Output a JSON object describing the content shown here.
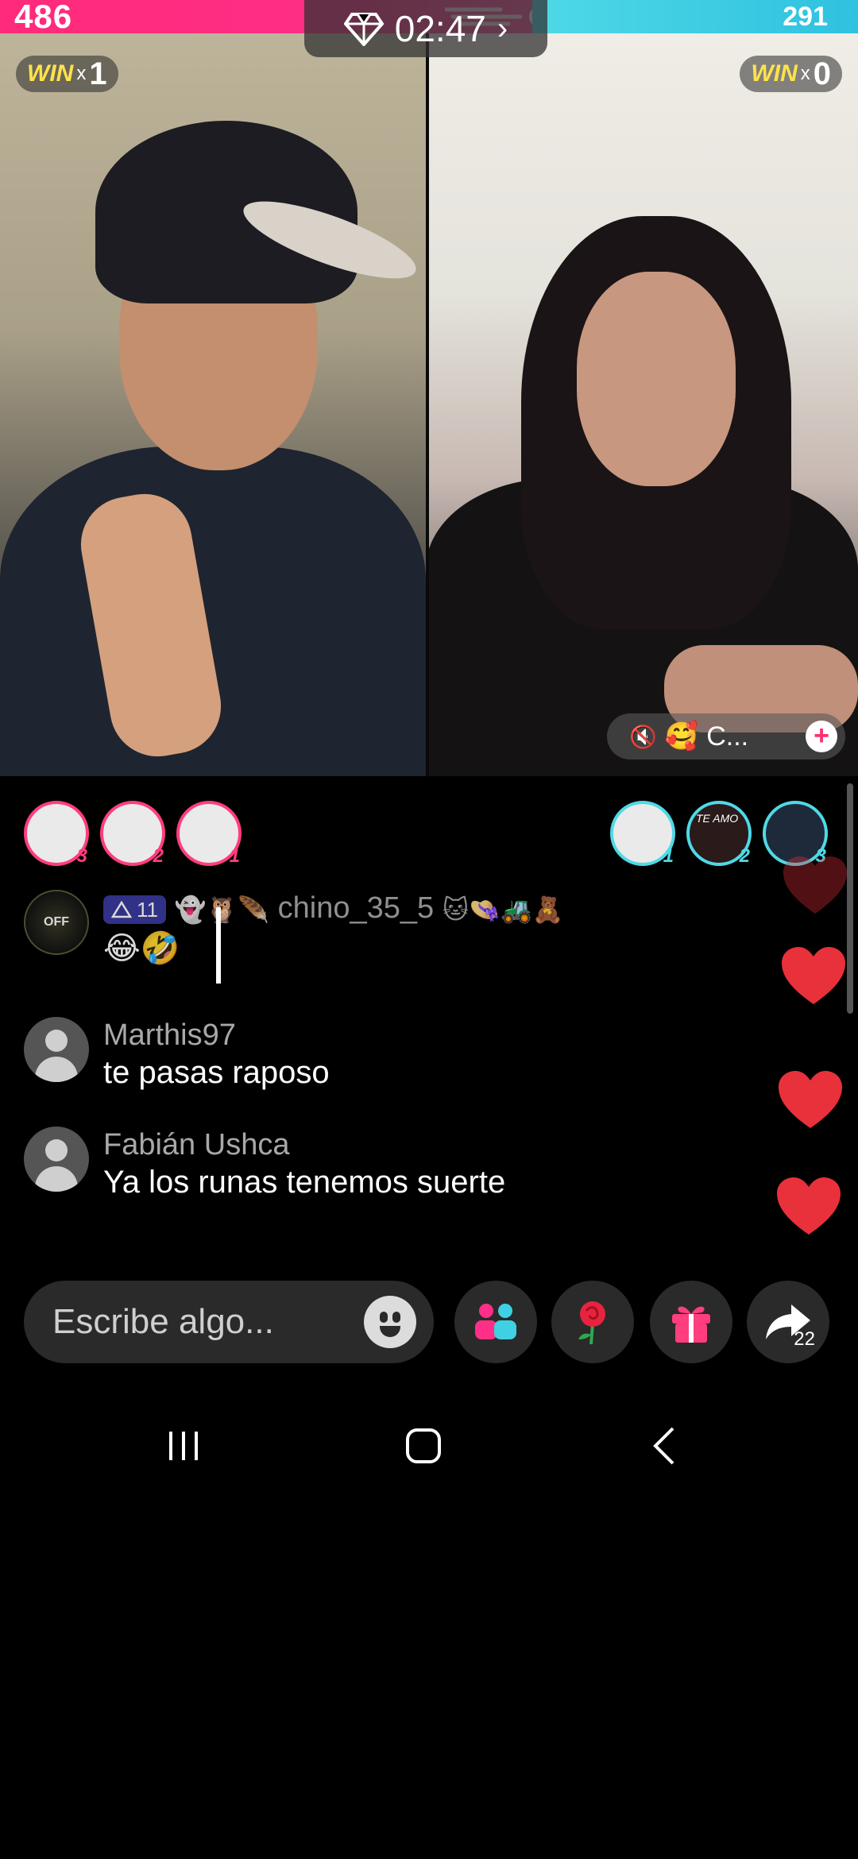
{
  "battle": {
    "left_score": "486",
    "right_score": "291",
    "timer": "02:47",
    "timer_chevron": "›",
    "left_win_label": "WIN",
    "left_win_x": "x",
    "left_win_count": "1",
    "right_win_label": "WIN",
    "right_win_x": "x",
    "right_win_count": "0",
    "colors": {
      "left": "#ff2f88",
      "right": "#3fd0e4"
    }
  },
  "guest": {
    "name": "C...",
    "mute_icon": "speaker-mute-icon",
    "emoji": "🥰",
    "add_label": "+"
  },
  "top_gifters": {
    "left": [
      {
        "rank": "3"
      },
      {
        "rank": "2"
      },
      {
        "rank": "1"
      }
    ],
    "right": [
      {
        "rank": "1"
      },
      {
        "rank": "2",
        "text": "TE AMO"
      },
      {
        "rank": "3"
      }
    ]
  },
  "comments": [
    {
      "user": "chino_35_5",
      "level": "11",
      "badges": "👻🦉🪶",
      "trail": "🐱👒🚜🧸",
      "text": "😂🤣",
      "avatar_text": "OFF"
    },
    {
      "user": "Marthis97",
      "text": "te pasas raposo"
    },
    {
      "user": "Fabián Ushca",
      "text": "Ya los runas tenemos suerte"
    }
  ],
  "composer": {
    "placeholder": "Escribe algo...",
    "emoji_icon": "smiley-icon",
    "share_count": "22"
  },
  "actions": [
    "guests-icon",
    "rose-icon",
    "gift-icon",
    "share-icon"
  ],
  "system_nav": [
    "recents-icon",
    "home-icon",
    "back-icon"
  ]
}
